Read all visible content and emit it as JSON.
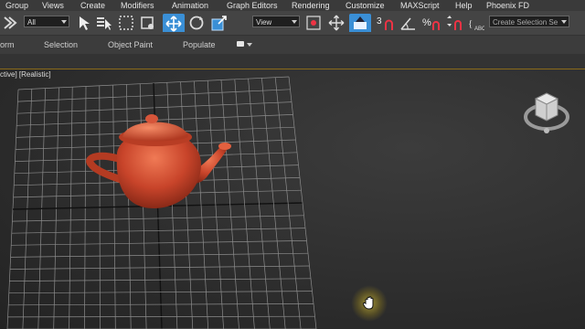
{
  "menu": [
    "Group",
    "Views",
    "Create",
    "Modifiers",
    "Animation",
    "Graph Editors",
    "Rendering",
    "Customize",
    "MAXScript",
    "Help",
    "Phoenix FD"
  ],
  "toolbar": {
    "filter_value": "All",
    "refcoord_value": "View",
    "snap_label": "3",
    "selection_set_placeholder": "Create Selection Se"
  },
  "ribbon": {
    "tabs": [
      "orm",
      "Selection",
      "Object Paint",
      "Populate"
    ]
  },
  "viewport": {
    "label": "ctive] [Realistic]"
  },
  "colors": {
    "teapot": "#c8442a",
    "grid": "#8c8c8c",
    "accent": "#3a8fd6"
  },
  "icons": [
    "select-object-icon",
    "select-by-name-icon",
    "rect-selection-icon",
    "window-crossing-icon",
    "move-icon",
    "rotate-icon",
    "scale-icon",
    "mirror-icon",
    "use-pivot-icon",
    "select-manipulate-icon",
    "snaps-toggle-icon",
    "angle-snap-icon",
    "percent-snap-icon",
    "spinner-snap-icon",
    "edit-named-sets-icon",
    "viewcube-icon",
    "pan-hand-cursor-icon"
  ]
}
